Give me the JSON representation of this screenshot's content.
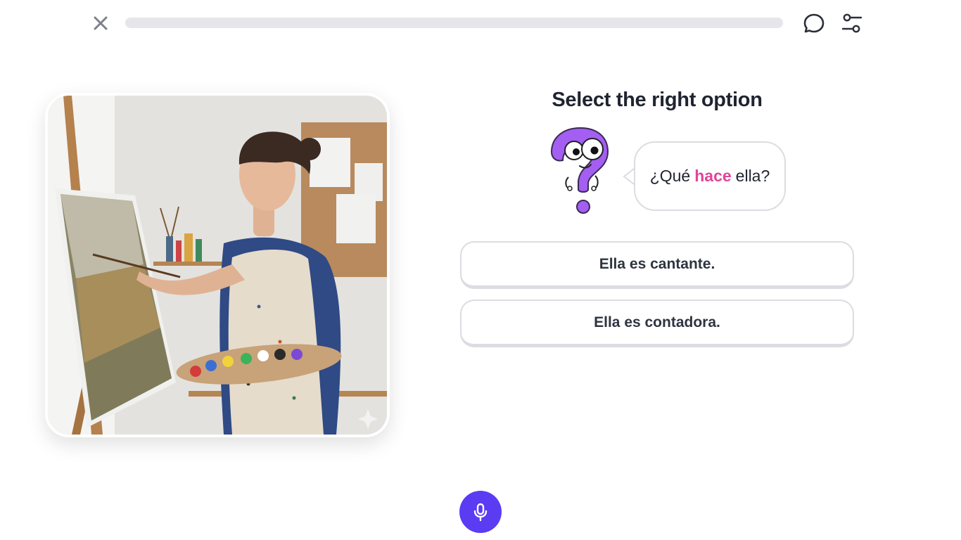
{
  "topbar": {
    "close_icon": "close-icon",
    "progress": 0,
    "chat_icon": "chat-bubble-icon",
    "settings_icon": "sliders-icon",
    "progress_color": "#58cc02"
  },
  "image": {
    "description_icon": "sparkle-icon"
  },
  "prompt": {
    "title": "Select the right option",
    "question_parts": [
      "¿Qué",
      "hace",
      "ella?"
    ],
    "highlight_color": "#e0459a"
  },
  "options": [
    {
      "label": "Ella es cantante."
    },
    {
      "label": "Ella es contadora."
    }
  ],
  "mic": {
    "icon": "microphone-icon",
    "color": "#5b3cf2"
  }
}
